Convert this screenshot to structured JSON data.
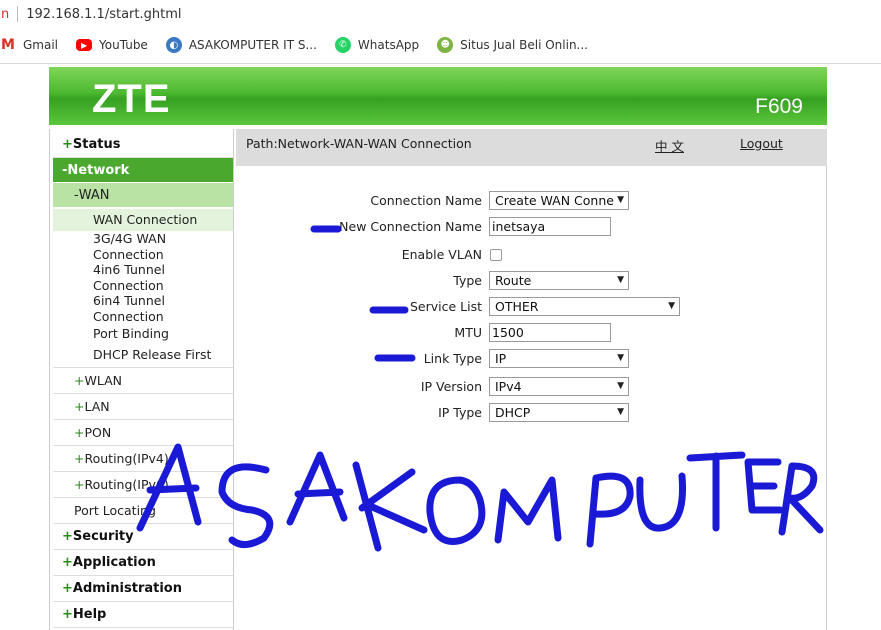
{
  "browser": {
    "url_fragment": "n",
    "url": "192.168.1.1/start.ghtml",
    "bookmarks": [
      {
        "label": "Gmail",
        "icon": "gmail-icon"
      },
      {
        "label": "YouTube",
        "icon": "youtube-icon"
      },
      {
        "label": "ASAKOMPUTER IT S...",
        "icon": "asakomputer-icon"
      },
      {
        "label": "WhatsApp",
        "icon": "whatsapp-icon"
      },
      {
        "label": "Situs Jual Beli Onlin...",
        "icon": "situs-icon"
      }
    ]
  },
  "header": {
    "logo": "ZTE",
    "model": "F609",
    "color": "#4cb82f"
  },
  "sidebar": {
    "status": "Status",
    "network": "Network",
    "wan": "WAN",
    "wan_items": [
      "WAN Connection",
      "3G/4G WAN Connection",
      "4in6 Tunnel Connection",
      "6in4 Tunnel Connection",
      "Port Binding",
      "DHCP Release First"
    ],
    "subs": [
      "WLAN",
      "LAN",
      "PON",
      "Routing(IPv4)",
      "Routing(IPv6)"
    ],
    "port_locating": "Port Locating",
    "security": "Security",
    "application": "Application",
    "administration": "Administration",
    "help": "Help"
  },
  "main": {
    "path": "Path:Network-WAN-WAN Connection",
    "lang": "中 文",
    "logout": "Logout",
    "form": {
      "connection_name_label": "Connection Name",
      "connection_name_value": "Create WAN Conne",
      "new_connection_name_label": "New Connection Name",
      "new_connection_name_value": "inetsaya",
      "enable_vlan_label": "Enable VLAN",
      "type_label": "Type",
      "type_value": "Route",
      "service_list_label": "Service List",
      "service_list_value": "OTHER",
      "mtu_label": "MTU",
      "mtu_value": "1500",
      "link_type_label": "Link Type",
      "link_type_value": "IP",
      "ip_version_label": "IP Version",
      "ip_version_value": "IPv4",
      "ip_type_label": "IP Type",
      "ip_type_value": "DHCP"
    }
  },
  "watermark": {
    "text": "ASAKOMPUTER",
    "color": "#1a1ad6"
  }
}
